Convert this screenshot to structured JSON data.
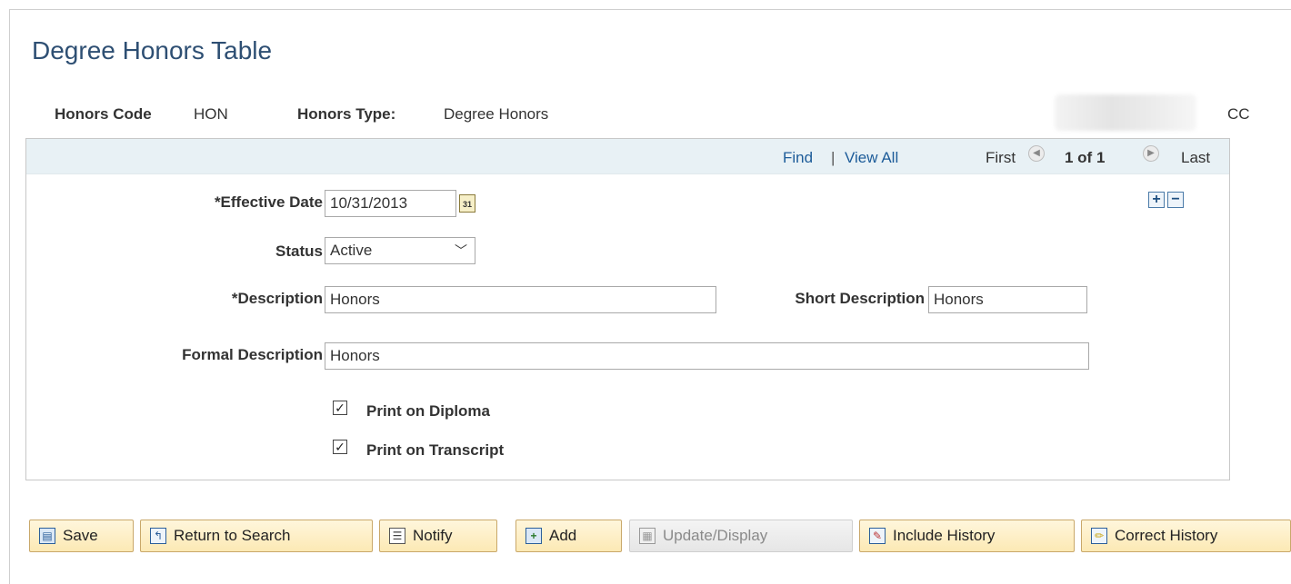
{
  "page": {
    "title": "Degree Honors Table"
  },
  "header": {
    "honors_code_label": "Honors Code",
    "honors_code_value": "HON",
    "honors_type_label": "Honors Type:",
    "honors_type_value": "Degree Honors",
    "institution_suffix": "CC"
  },
  "nav": {
    "find": "Find",
    "separator": "|",
    "view_all": "View All",
    "first": "First",
    "count": "1 of 1",
    "last": "Last"
  },
  "form": {
    "effective_date_label": "*Effective Date",
    "effective_date_value": "10/31/2013",
    "calendar_icon_text": "31",
    "status_label": "Status",
    "status_value": "Active",
    "description_label": "*Description",
    "description_value": "Honors",
    "short_description_label": "Short Description",
    "short_description_value": "Honors",
    "formal_description_label": "Formal Description",
    "formal_description_value": "Honors",
    "print_on_diploma_label": "Print on Diploma",
    "print_on_diploma_checked": true,
    "print_on_transcript_label": "Print on Transcript",
    "print_on_transcript_checked": true,
    "add_row": "+",
    "delete_row": "−"
  },
  "toolbar": {
    "save": "Save",
    "return_to_search": "Return to Search",
    "notify": "Notify",
    "add": "Add",
    "update_display": "Update/Display",
    "include_history": "Include History",
    "correct_history": "Correct History"
  },
  "colors": {
    "title": "#2e4f73",
    "link": "#1d5c99",
    "group_header_bg": "#e8f1f5",
    "button_bg": "#fce9b4",
    "button_border": "#c9a86a"
  }
}
